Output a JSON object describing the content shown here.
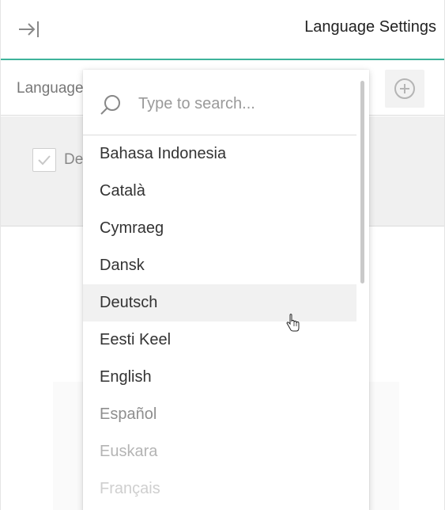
{
  "header": {
    "title": "Language Settings"
  },
  "language_row": {
    "label": "Language"
  },
  "panel": {
    "default_label": "De"
  },
  "dropdown": {
    "search_placeholder": "Type to search...",
    "options": [
      "Bahasa Indonesia",
      "Català",
      "Cymraeg",
      "Dansk",
      "Deutsch",
      "Eesti Keel",
      "English",
      "Español",
      "Euskara",
      "Français"
    ],
    "hovered_option": "Deutsch"
  },
  "colors": {
    "accent": "#3eb39b",
    "hover_bg": "#f1f1f1"
  }
}
